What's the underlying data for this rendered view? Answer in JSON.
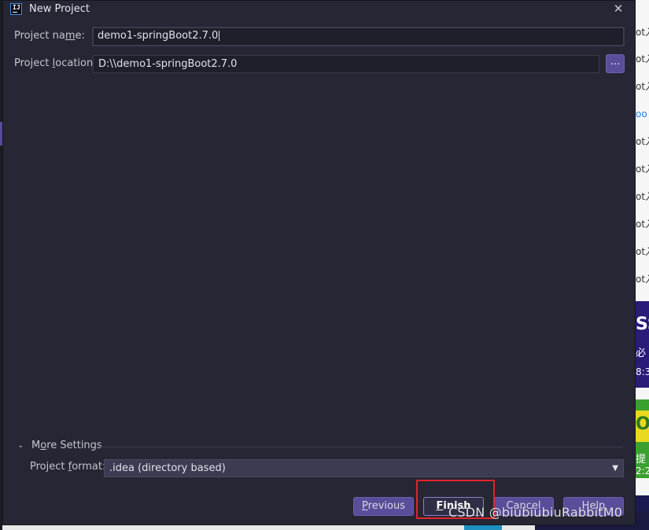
{
  "dialog": {
    "title": "New Project",
    "close_glyph": "✕",
    "app_icon_text": "IJ"
  },
  "form": {
    "project_name_label_pre": "Project na",
    "project_name_label_ul": "m",
    "project_name_label_post": "e:",
    "project_name_value": "demo1-springBoot2.7.0",
    "project_location_label_pre": "Project ",
    "project_location_label_ul": "l",
    "project_location_label_post": "ocation:",
    "project_location_value": "D:\\\\demo1-springBoot2.7.0",
    "browse_label": "..."
  },
  "more_settings": {
    "chevron": "⌄",
    "label_pre": "M",
    "label_ul": "o",
    "label_post": "re Settings",
    "format_label_pre": "Project ",
    "format_label_ul": "f",
    "format_label_post": "ormat:",
    "format_value": ".idea (directory based)",
    "arrow": "▼"
  },
  "buttons": {
    "previous_ul": "P",
    "previous_post": "revious",
    "finish_ul": "F",
    "finish_post": "inish",
    "cancel": "Cancel",
    "help": "Help"
  },
  "background": {
    "lines": [
      "ot入",
      "ot入",
      "ot入",
      "oo",
      "ot入",
      "ot入",
      "ot入",
      "ot入",
      "ot入",
      "ot入"
    ],
    "card1_text": [
      "SS",
      "必",
      "8:3"
    ],
    "card2_text": [
      "O",
      "提",
      "2:2"
    ]
  },
  "watermark": "CSDN @biubiubiuRabbitM0",
  "colors": {
    "dialog_bg": "#262634",
    "accent_button": "#5a4e9a",
    "highlight_box": "#e3242b"
  }
}
